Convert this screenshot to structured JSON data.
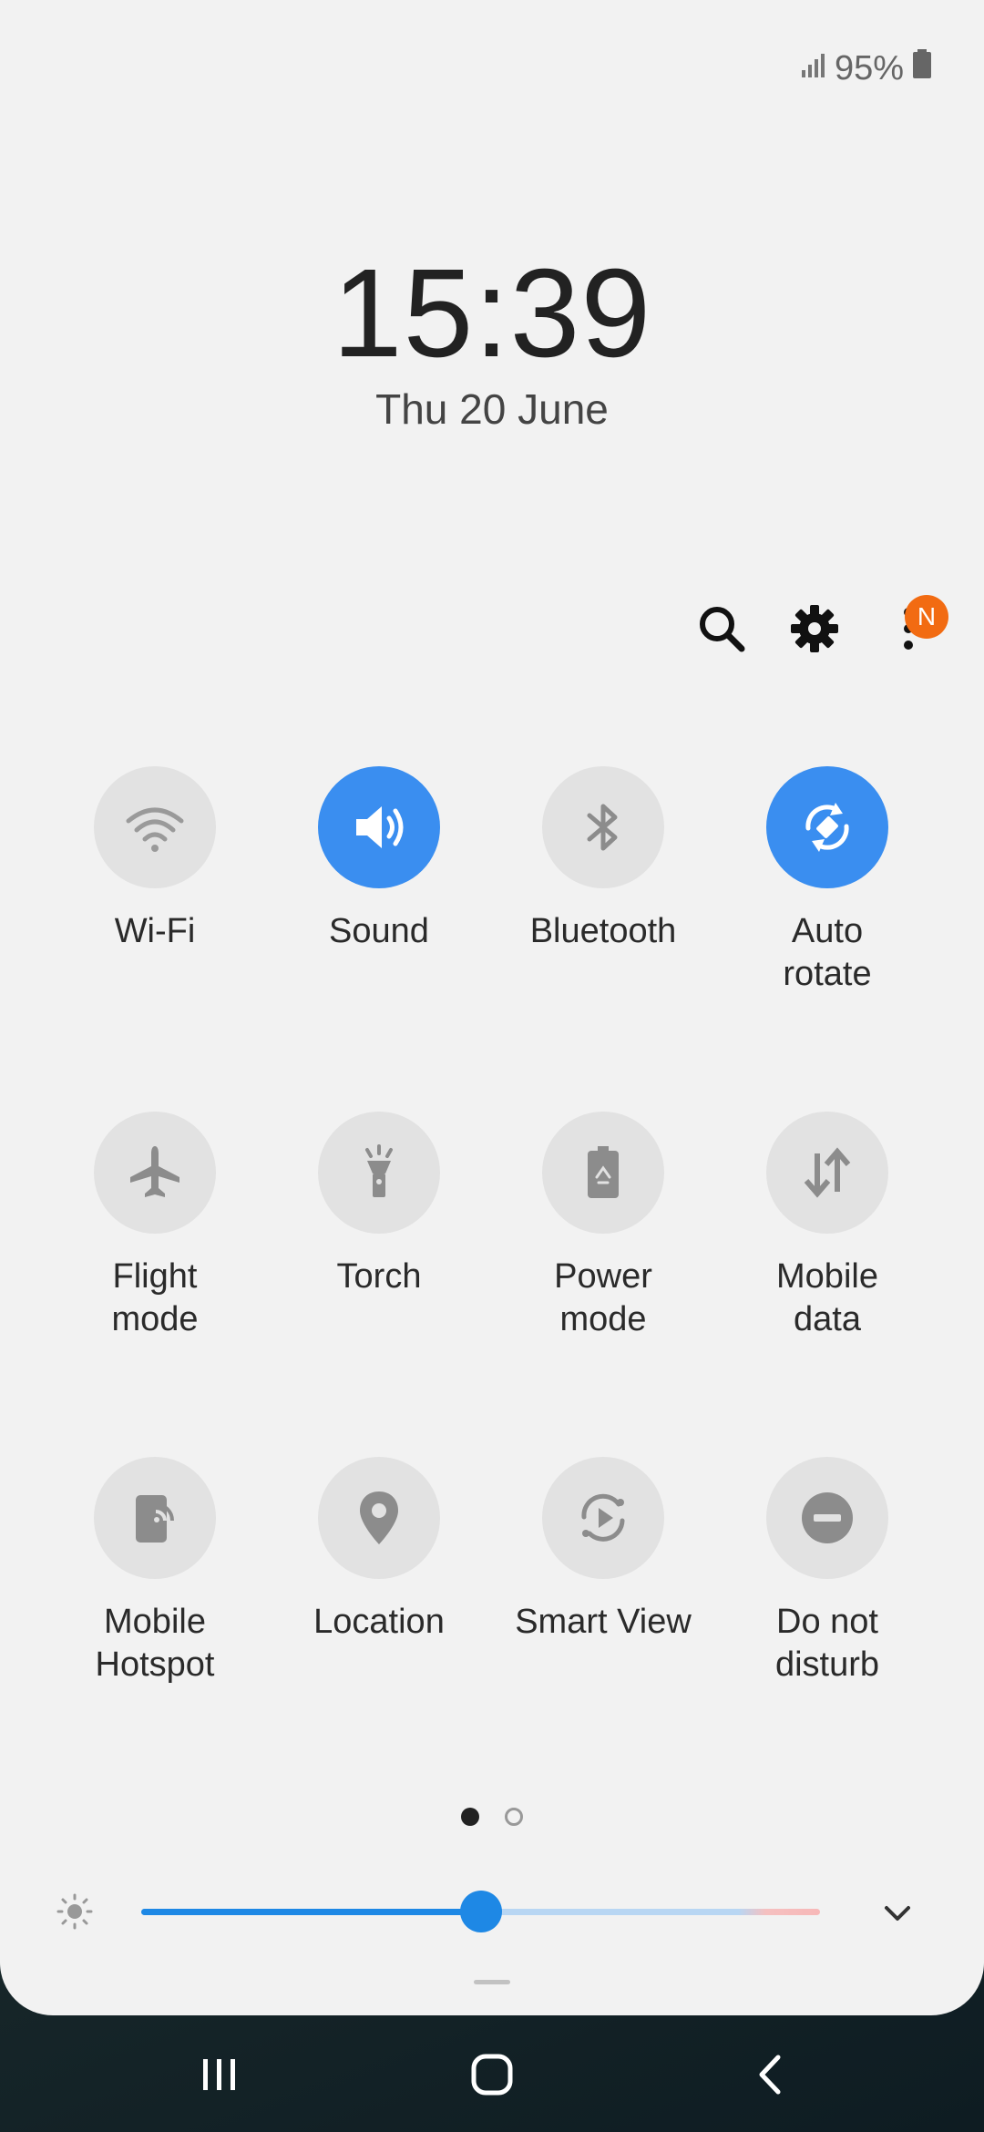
{
  "status": {
    "battery_percent": "95%",
    "signal_icon": "signal-icon",
    "battery_icon": "battery-icon",
    "battery_level": 0.95
  },
  "clock": {
    "time": "15:39",
    "date": "Thu 20 June"
  },
  "toolbar": {
    "notification_badge": "N"
  },
  "tiles": [
    {
      "label": "Wi-Fi",
      "icon": "wifi-icon",
      "active": false
    },
    {
      "label": "Sound",
      "icon": "sound-icon",
      "active": true
    },
    {
      "label": "Bluetooth",
      "icon": "bluetooth-icon",
      "active": false
    },
    {
      "label": "Auto\nrotate",
      "icon": "auto-rotate-icon",
      "active": true
    },
    {
      "label": "Flight\nmode",
      "icon": "airplane-icon",
      "active": false
    },
    {
      "label": "Torch",
      "icon": "torch-icon",
      "active": false
    },
    {
      "label": "Power\nmode",
      "icon": "power-mode-icon",
      "active": false
    },
    {
      "label": "Mobile\ndata",
      "icon": "mobile-data-icon",
      "active": false
    },
    {
      "label": "Mobile\nHotspot",
      "icon": "hotspot-icon",
      "active": false
    },
    {
      "label": "Location",
      "icon": "location-icon",
      "active": false
    },
    {
      "label": "Smart View",
      "icon": "smart-view-icon",
      "active": false
    },
    {
      "label": "Do not\ndisturb",
      "icon": "do-not-disturb-icon",
      "active": false
    }
  ],
  "pager": {
    "pages": 2,
    "current": 1
  },
  "brightness": {
    "level": 0.5
  },
  "colors": {
    "accent": "#3a8ef0",
    "slider": "#1e88e5",
    "badge": "#f26b12",
    "tile_off": "#e2e2e2",
    "icon_off": "#8c8c8c"
  }
}
